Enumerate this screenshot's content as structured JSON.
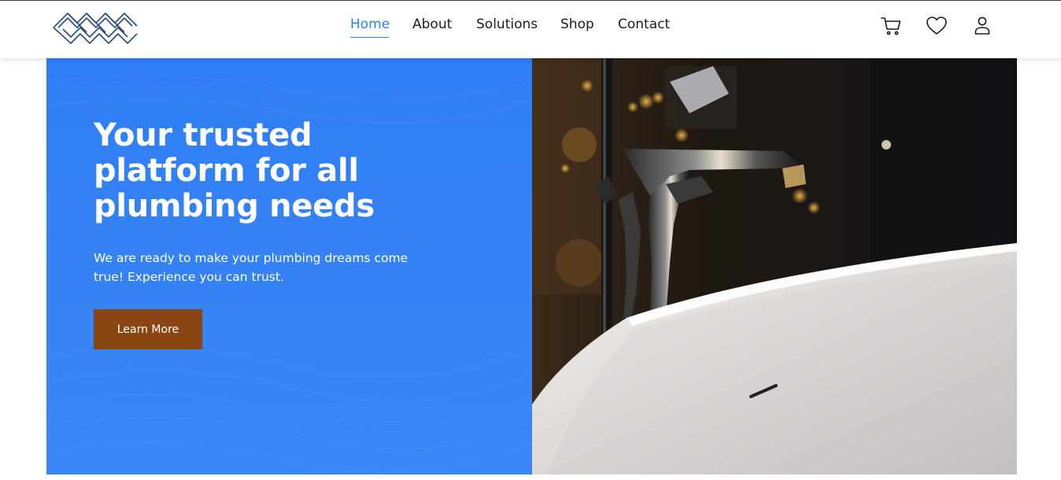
{
  "nav": {
    "items": [
      {
        "label": "Home",
        "active": true
      },
      {
        "label": "About",
        "active": false
      },
      {
        "label": "Solutions",
        "active": false
      },
      {
        "label": "Shop",
        "active": false
      },
      {
        "label": "Contact",
        "active": false
      }
    ],
    "active_color": "#2f7ef5"
  },
  "header_icons": [
    "cart-icon",
    "heart-icon",
    "user-icon"
  ],
  "hero": {
    "headline": "Your trusted platform for all plumbing needs",
    "subtext": "We are ready to make your plumbing dreams come true! Experience you can trust.",
    "cta_label": "Learn More",
    "background_color": "#2f7ef5",
    "cta_color": "#8b4513"
  },
  "hero_image": {
    "subject": "bathroom-faucet-over-bathtub"
  }
}
